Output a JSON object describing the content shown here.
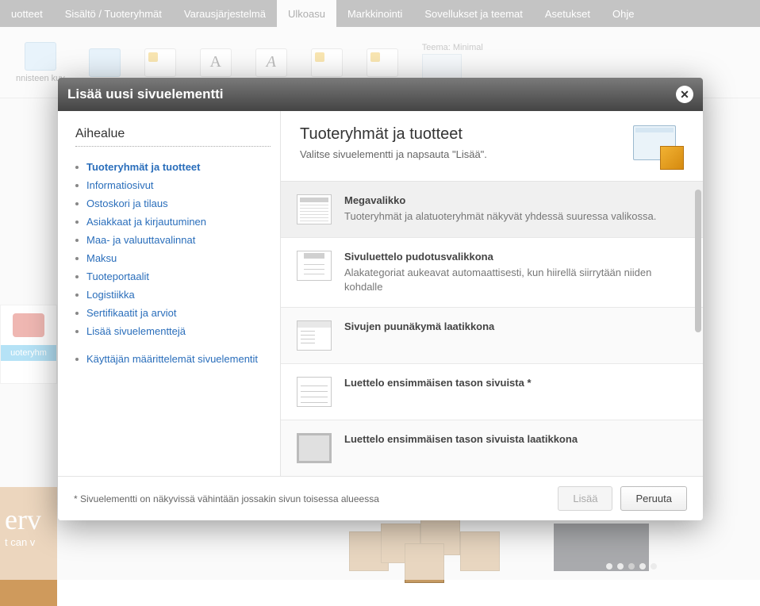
{
  "topTabs": [
    {
      "label": "uotteet"
    },
    {
      "label": "Sisältö / Tuoteryhmät"
    },
    {
      "label": "Varausjärjestelmä"
    },
    {
      "label": "Ulkoasu",
      "active": true
    },
    {
      "label": "Markkinointi"
    },
    {
      "label": "Sovellukset ja teemat"
    },
    {
      "label": "Asetukset"
    },
    {
      "label": "Ohje"
    }
  ],
  "ribbon": {
    "item1": "nnisteen kuv",
    "theme_label": "Teema: Minimal"
  },
  "bg": {
    "blueWidget": "uoteryhm",
    "bannerBig": "rv",
    "bannerSmall": "t can v"
  },
  "modal": {
    "title": "Lisää uusi sivuelementti",
    "sidebar": {
      "heading": "Aihealue",
      "links": [
        {
          "label": "Tuoteryhmät ja tuotteet",
          "active": true
        },
        {
          "label": "Informatiosivut"
        },
        {
          "label": "Ostoskori ja tilaus"
        },
        {
          "label": "Asiakkaat ja kirjautuminen"
        },
        {
          "label": "Maa- ja valuuttavalinnat"
        },
        {
          "label": "Maksu"
        },
        {
          "label": "Tuoteportaalit"
        },
        {
          "label": "Logistiikka"
        },
        {
          "label": "Sertifikaatit ja arviot"
        },
        {
          "label": "Lisää sivuelementtejä"
        }
      ],
      "extraLink": "Käyttäjän määrittelemät sivuelementit"
    },
    "main": {
      "title": "Tuoteryhmät ja tuotteet",
      "subtitle": "Valitse sivuelementti ja napsauta \"Lisää\".",
      "elements": [
        {
          "title": "Megavalikko",
          "desc": "Tuoteryhmät ja alatuoteryhmät näkyvät yhdessä suuressa valikossa.",
          "icon": "mega",
          "selected": true
        },
        {
          "title": "Sivuluettelo pudotusvalikkona",
          "desc": "Alakategoriat aukeavat automaattisesti, kun hiirellä siirrytään niiden kohdalle",
          "icon": "dropdown"
        },
        {
          "title": "Sivujen puunäkymä laatikkona",
          "desc": "",
          "icon": "tree",
          "alt": true
        },
        {
          "title": "Luettelo ensimmäisen tason sivuista *",
          "desc": "",
          "icon": "list"
        },
        {
          "title": "Luettelo ensimmäisen tason sivuista laatikkona",
          "desc": "",
          "icon": "box",
          "alt": true
        }
      ]
    },
    "footer": {
      "note": "* Sivuelementti on näkyvissä vähintään jossakin sivun toisessa alueessa",
      "add": "Lisää",
      "cancel": "Peruuta"
    }
  }
}
